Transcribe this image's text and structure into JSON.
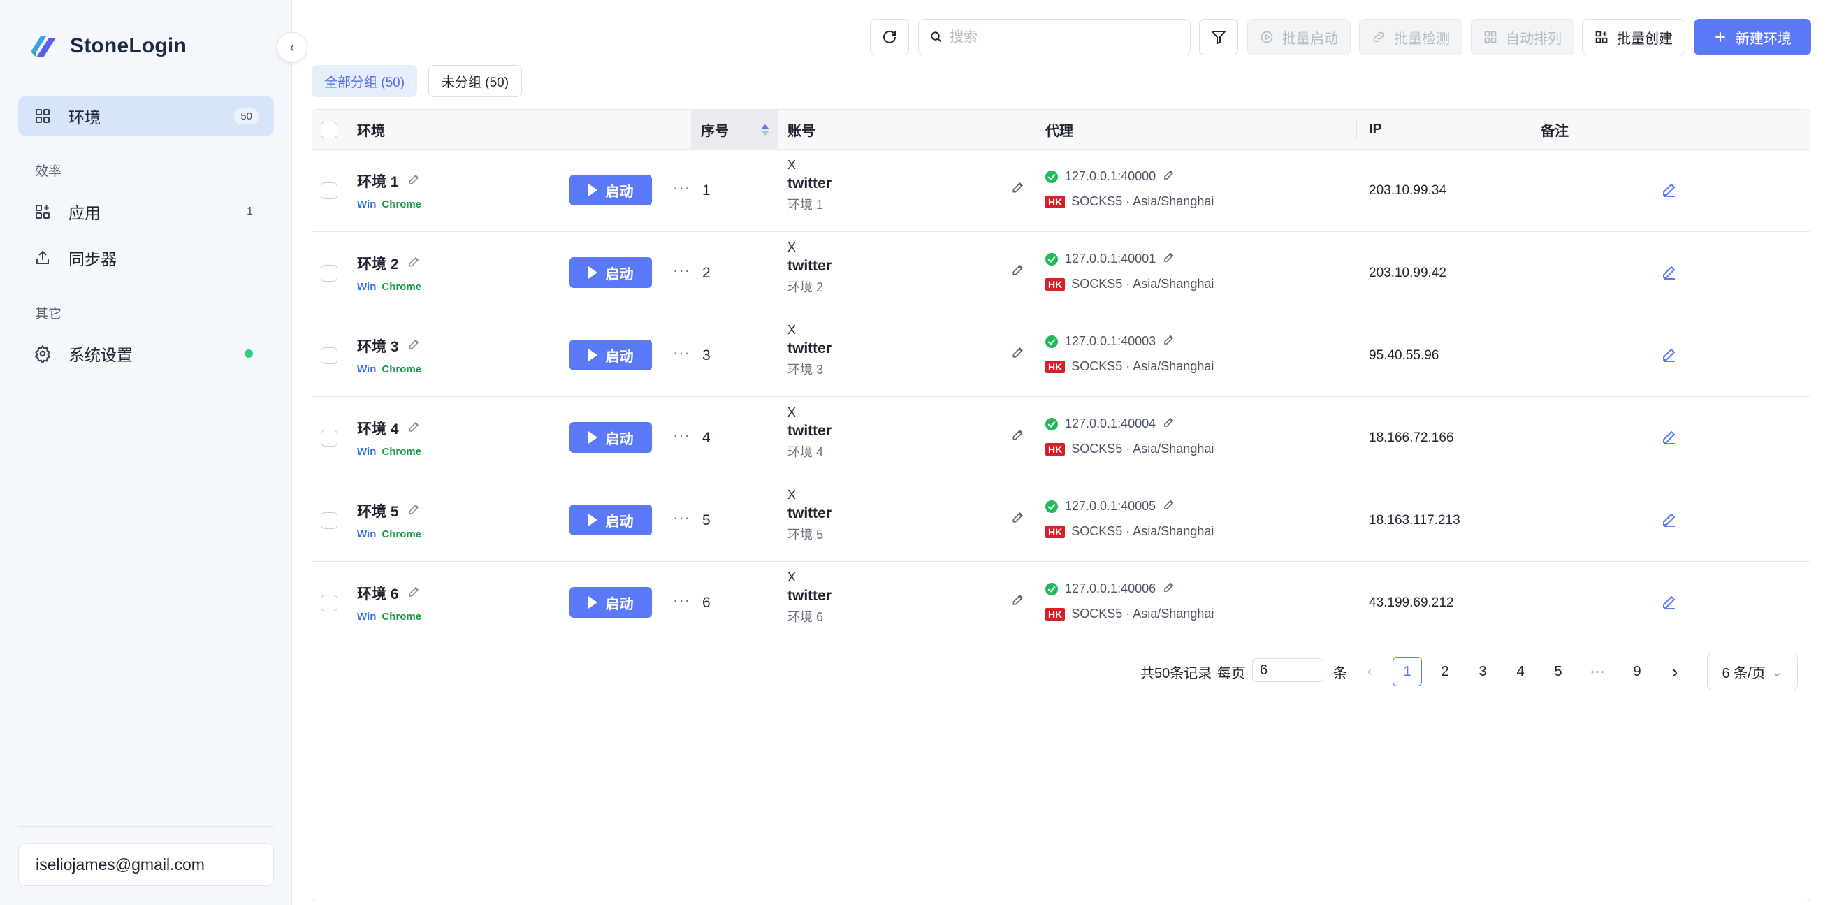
{
  "sidebar": {
    "brand": "StoneLogin",
    "nav": [
      {
        "label": "环境",
        "badge": "50"
      }
    ],
    "section_efficiency": "效率",
    "efficiency_items": [
      {
        "label": "应用",
        "count": "1"
      },
      {
        "label": "同步器"
      }
    ],
    "section_other": "其它",
    "other_items": [
      {
        "label": "系统设置"
      }
    ],
    "user_email": "iseliojames@gmail.com"
  },
  "toolbar": {
    "search_placeholder": "搜索",
    "batch_start": "批量启动",
    "batch_check": "批量检测",
    "auto_arrange": "自动排列",
    "batch_create": "批量创建",
    "new_env": "新建环境"
  },
  "group_tabs": [
    {
      "label": "全部分组 (50)"
    },
    {
      "label": "未分组 (50)"
    }
  ],
  "table": {
    "headers": {
      "env": "环境",
      "seq": "序号",
      "account": "账号",
      "proxy": "代理",
      "ip": "IP",
      "note": "备注"
    },
    "start_label": "启动",
    "rows": [
      {
        "name": "环境 1",
        "os": "Win",
        "browser": "Chrome",
        "seq": "1",
        "platform": "X",
        "account": "twitter",
        "account_env": "环境 1",
        "proxy": "127.0.0.1:40000",
        "proxy_flag": "HK",
        "proxy_info": "SOCKS5 · Asia/Shanghai",
        "ip": "203.10.99.34"
      },
      {
        "name": "环境 2",
        "os": "Win",
        "browser": "Chrome",
        "seq": "2",
        "platform": "X",
        "account": "twitter",
        "account_env": "环境 2",
        "proxy": "127.0.0.1:40001",
        "proxy_flag": "HK",
        "proxy_info": "SOCKS5 · Asia/Shanghai",
        "ip": "203.10.99.42"
      },
      {
        "name": "环境 3",
        "os": "Win",
        "browser": "Chrome",
        "seq": "3",
        "platform": "X",
        "account": "twitter",
        "account_env": "环境 3",
        "proxy": "127.0.0.1:40003",
        "proxy_flag": "HK",
        "proxy_info": "SOCKS5 · Asia/Shanghai",
        "ip": "95.40.55.96"
      },
      {
        "name": "环境 4",
        "os": "Win",
        "browser": "Chrome",
        "seq": "4",
        "platform": "X",
        "account": "twitter",
        "account_env": "环境 4",
        "proxy": "127.0.0.1:40004",
        "proxy_flag": "HK",
        "proxy_info": "SOCKS5 · Asia/Shanghai",
        "ip": "18.166.72.166"
      },
      {
        "name": "环境 5",
        "os": "Win",
        "browser": "Chrome",
        "seq": "5",
        "platform": "X",
        "account": "twitter",
        "account_env": "环境 5",
        "proxy": "127.0.0.1:40005",
        "proxy_flag": "HK",
        "proxy_info": "SOCKS5 · Asia/Shanghai",
        "ip": "18.163.117.213"
      },
      {
        "name": "环境 6",
        "os": "Win",
        "browser": "Chrome",
        "seq": "6",
        "platform": "X",
        "account": "twitter",
        "account_env": "环境 6",
        "proxy": "127.0.0.1:40006",
        "proxy_flag": "HK",
        "proxy_info": "SOCKS5 · Asia/Shanghai",
        "ip": "43.199.69.212"
      }
    ]
  },
  "pagination": {
    "total": "共50条记录",
    "per_page_label": "每页",
    "per_page_value": "6",
    "per_page_unit": "条",
    "pages": [
      "1",
      "2",
      "3",
      "4",
      "5"
    ],
    "ellipsis": "•••",
    "last_page": "9",
    "current_page": "1",
    "page_size_label": "6 条/页"
  },
  "colors": {
    "primary": "#5b78f6",
    "sidebar_bg": "#f4f7fc",
    "active_nav": "#d7e5fb",
    "status_ok": "#22b85c",
    "hk_flag": "#d61f26"
  }
}
